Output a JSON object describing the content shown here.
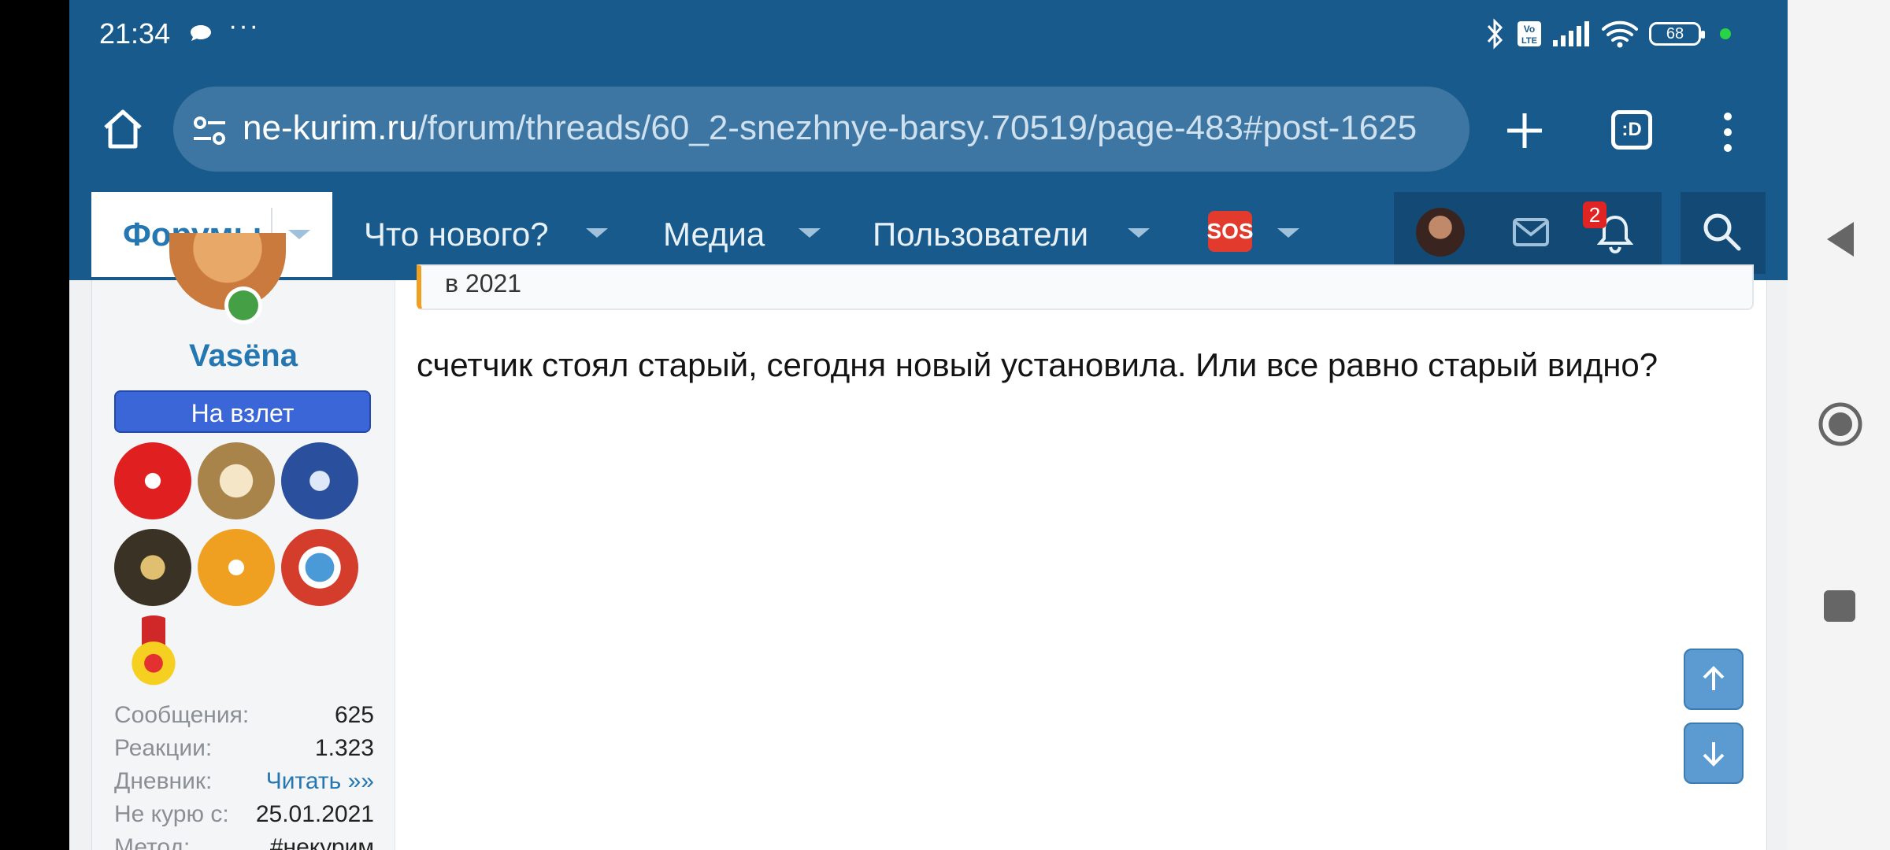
{
  "status_bar": {
    "time": "21:34",
    "overflow": "···",
    "battery": "68",
    "network": "Vo LTE"
  },
  "browser": {
    "url_host": "ne-kurim.ru",
    "url_path": "/forum/threads/60_2-snezhnye-barsy.70519/page-483#post-1625",
    "tab_label": ":D"
  },
  "site_nav": {
    "active": "Форумы",
    "items": [
      "Что нового?",
      "Медиа",
      "Пользователи"
    ],
    "sos_label": "SOS",
    "notification_count": "2"
  },
  "post": {
    "quote_text": "в 2021",
    "message": "счетчик стоял старый, сегодня новый установила. Или все равно старый видно?"
  },
  "user": {
    "name": "Vasëna",
    "title": "На взлет",
    "stats": [
      {
        "label": "Сообщения:",
        "value": "625"
      },
      {
        "label": "Реакции:",
        "value": "1.323"
      },
      {
        "label": "Дневник:",
        "value": "Читать »»"
      },
      {
        "label": "Не курю с:",
        "value": "25.01.2021"
      },
      {
        "label": "Метод:",
        "value": "#некурим"
      }
    ]
  },
  "colors": {
    "header": "#185a8c",
    "accent": "#2577b1",
    "usertitle": "#3b66d8"
  }
}
